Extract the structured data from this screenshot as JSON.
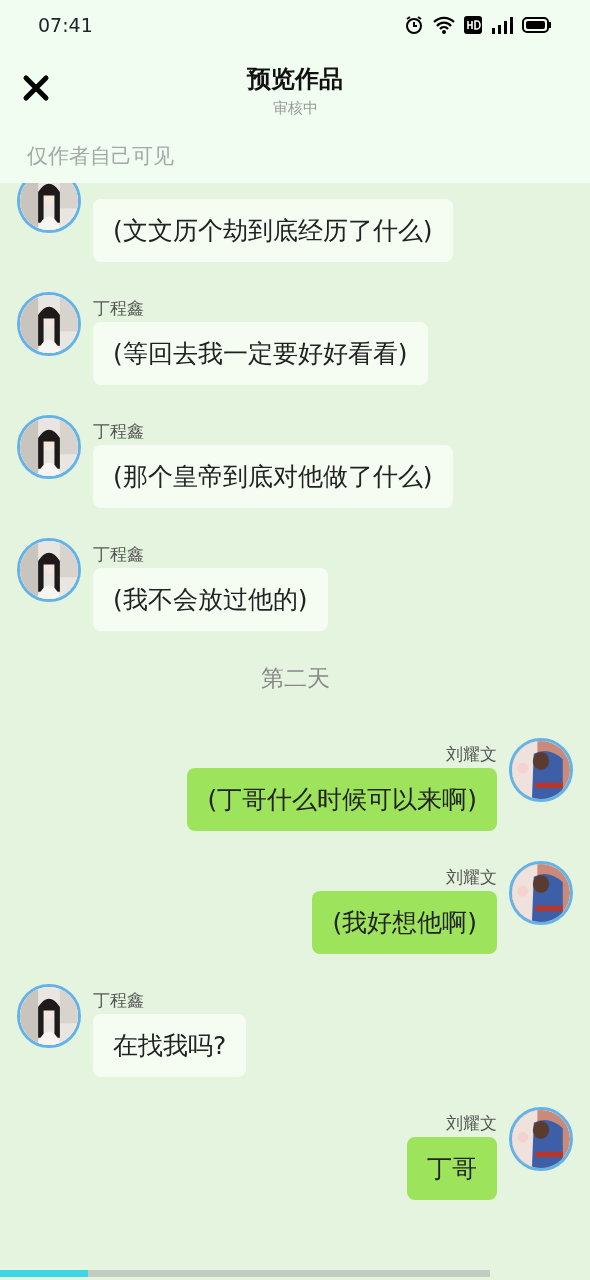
{
  "status_bar": {
    "time": "07:41"
  },
  "header": {
    "title": "预览作品",
    "subtitle": "审核中"
  },
  "notice": "仅作者自己可见",
  "messages": [
    {
      "kind": "left",
      "text": "(文文历个劫到底经历了什么)"
    },
    {
      "kind": "left",
      "sender": "丁程鑫",
      "text": "(等回去我一定要好好看看)"
    },
    {
      "kind": "left",
      "sender": "丁程鑫",
      "text": "(那个皇帝到底对他做了什么)"
    },
    {
      "kind": "left",
      "sender": "丁程鑫",
      "text": "(我不会放过他的)"
    },
    {
      "kind": "divider",
      "text": "第二天"
    },
    {
      "kind": "right",
      "sender": "刘耀文",
      "text": "(丁哥什么时候可以来啊)"
    },
    {
      "kind": "right",
      "sender": "刘耀文",
      "text": "(我好想他啊)"
    },
    {
      "kind": "left",
      "sender": "丁程鑫",
      "text": "在找我吗?"
    },
    {
      "kind": "right",
      "sender": "刘耀文",
      "text": "丁哥"
    }
  ],
  "progress": {
    "level": 0.18
  }
}
